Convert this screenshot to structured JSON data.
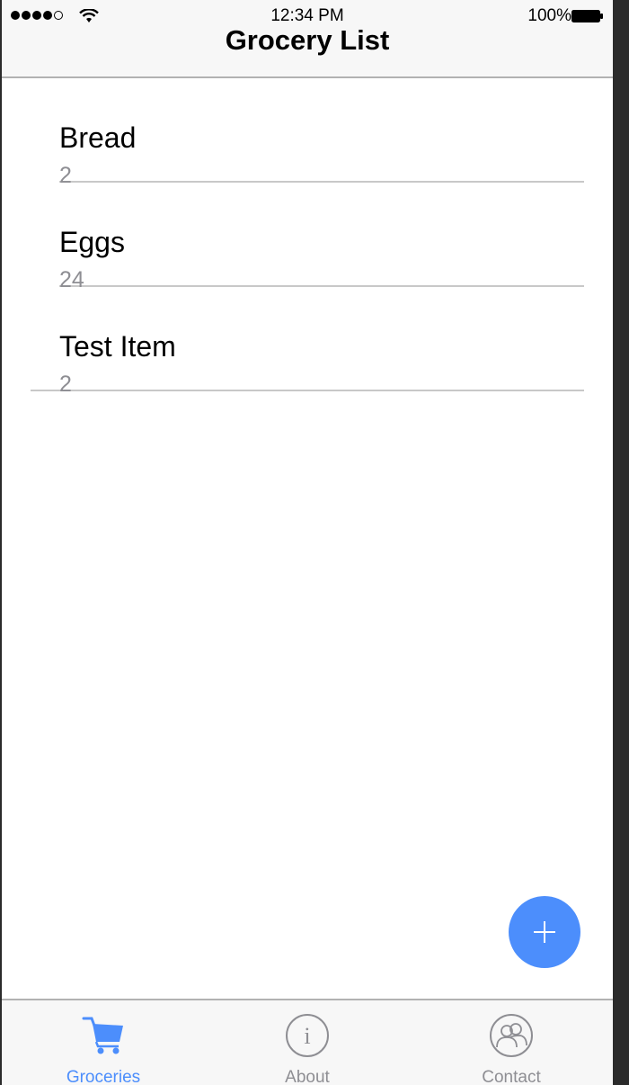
{
  "status_bar": {
    "time": "12:34 PM",
    "battery": "100%",
    "signal_icon": "signal-dots-icon",
    "wifi_icon": "wifi-icon",
    "battery_icon": "battery-icon"
  },
  "nav": {
    "title": "Grocery List"
  },
  "groceries": [
    {
      "name": "Bread",
      "quantity": "2"
    },
    {
      "name": "Eggs",
      "quantity": "24"
    },
    {
      "name": "Test Item",
      "quantity": "2"
    }
  ],
  "fab": {
    "icon": "plus-icon"
  },
  "tabs": [
    {
      "label": "Groceries",
      "icon": "cart-icon",
      "active": true
    },
    {
      "label": "About",
      "icon": "info-icon",
      "active": false
    },
    {
      "label": "Contact",
      "icon": "contact-icon",
      "active": false
    }
  ],
  "colors": {
    "accent": "#4c8efc",
    "secondary_text": "#8e8e93",
    "bar_background": "#f7f7f7"
  }
}
